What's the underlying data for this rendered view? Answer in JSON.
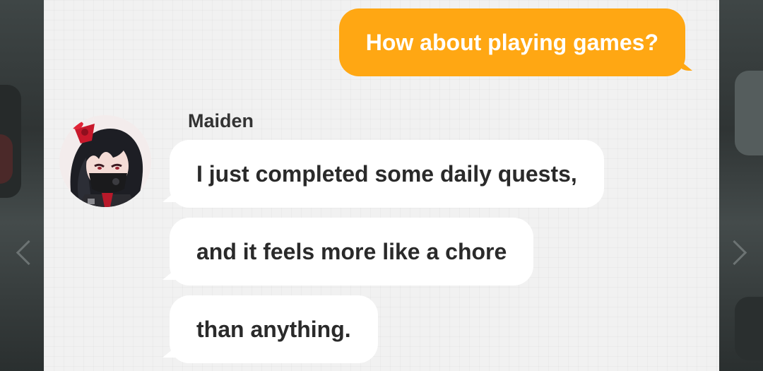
{
  "conversation": {
    "outgoing": [
      {
        "text": "How about playing games?"
      }
    ],
    "incoming": {
      "sender": "Maiden",
      "messages": [
        {
          "text": "I just completed some daily quests,"
        },
        {
          "text": "and it feels more like a chore"
        },
        {
          "text": "than anything."
        }
      ]
    }
  },
  "colors": {
    "outgoing_bubble": "#ffa713",
    "incoming_bubble": "#ffffff",
    "panel_background": "#f1f1f1"
  },
  "icons": {
    "avatar": "maiden-avatar-icon"
  }
}
